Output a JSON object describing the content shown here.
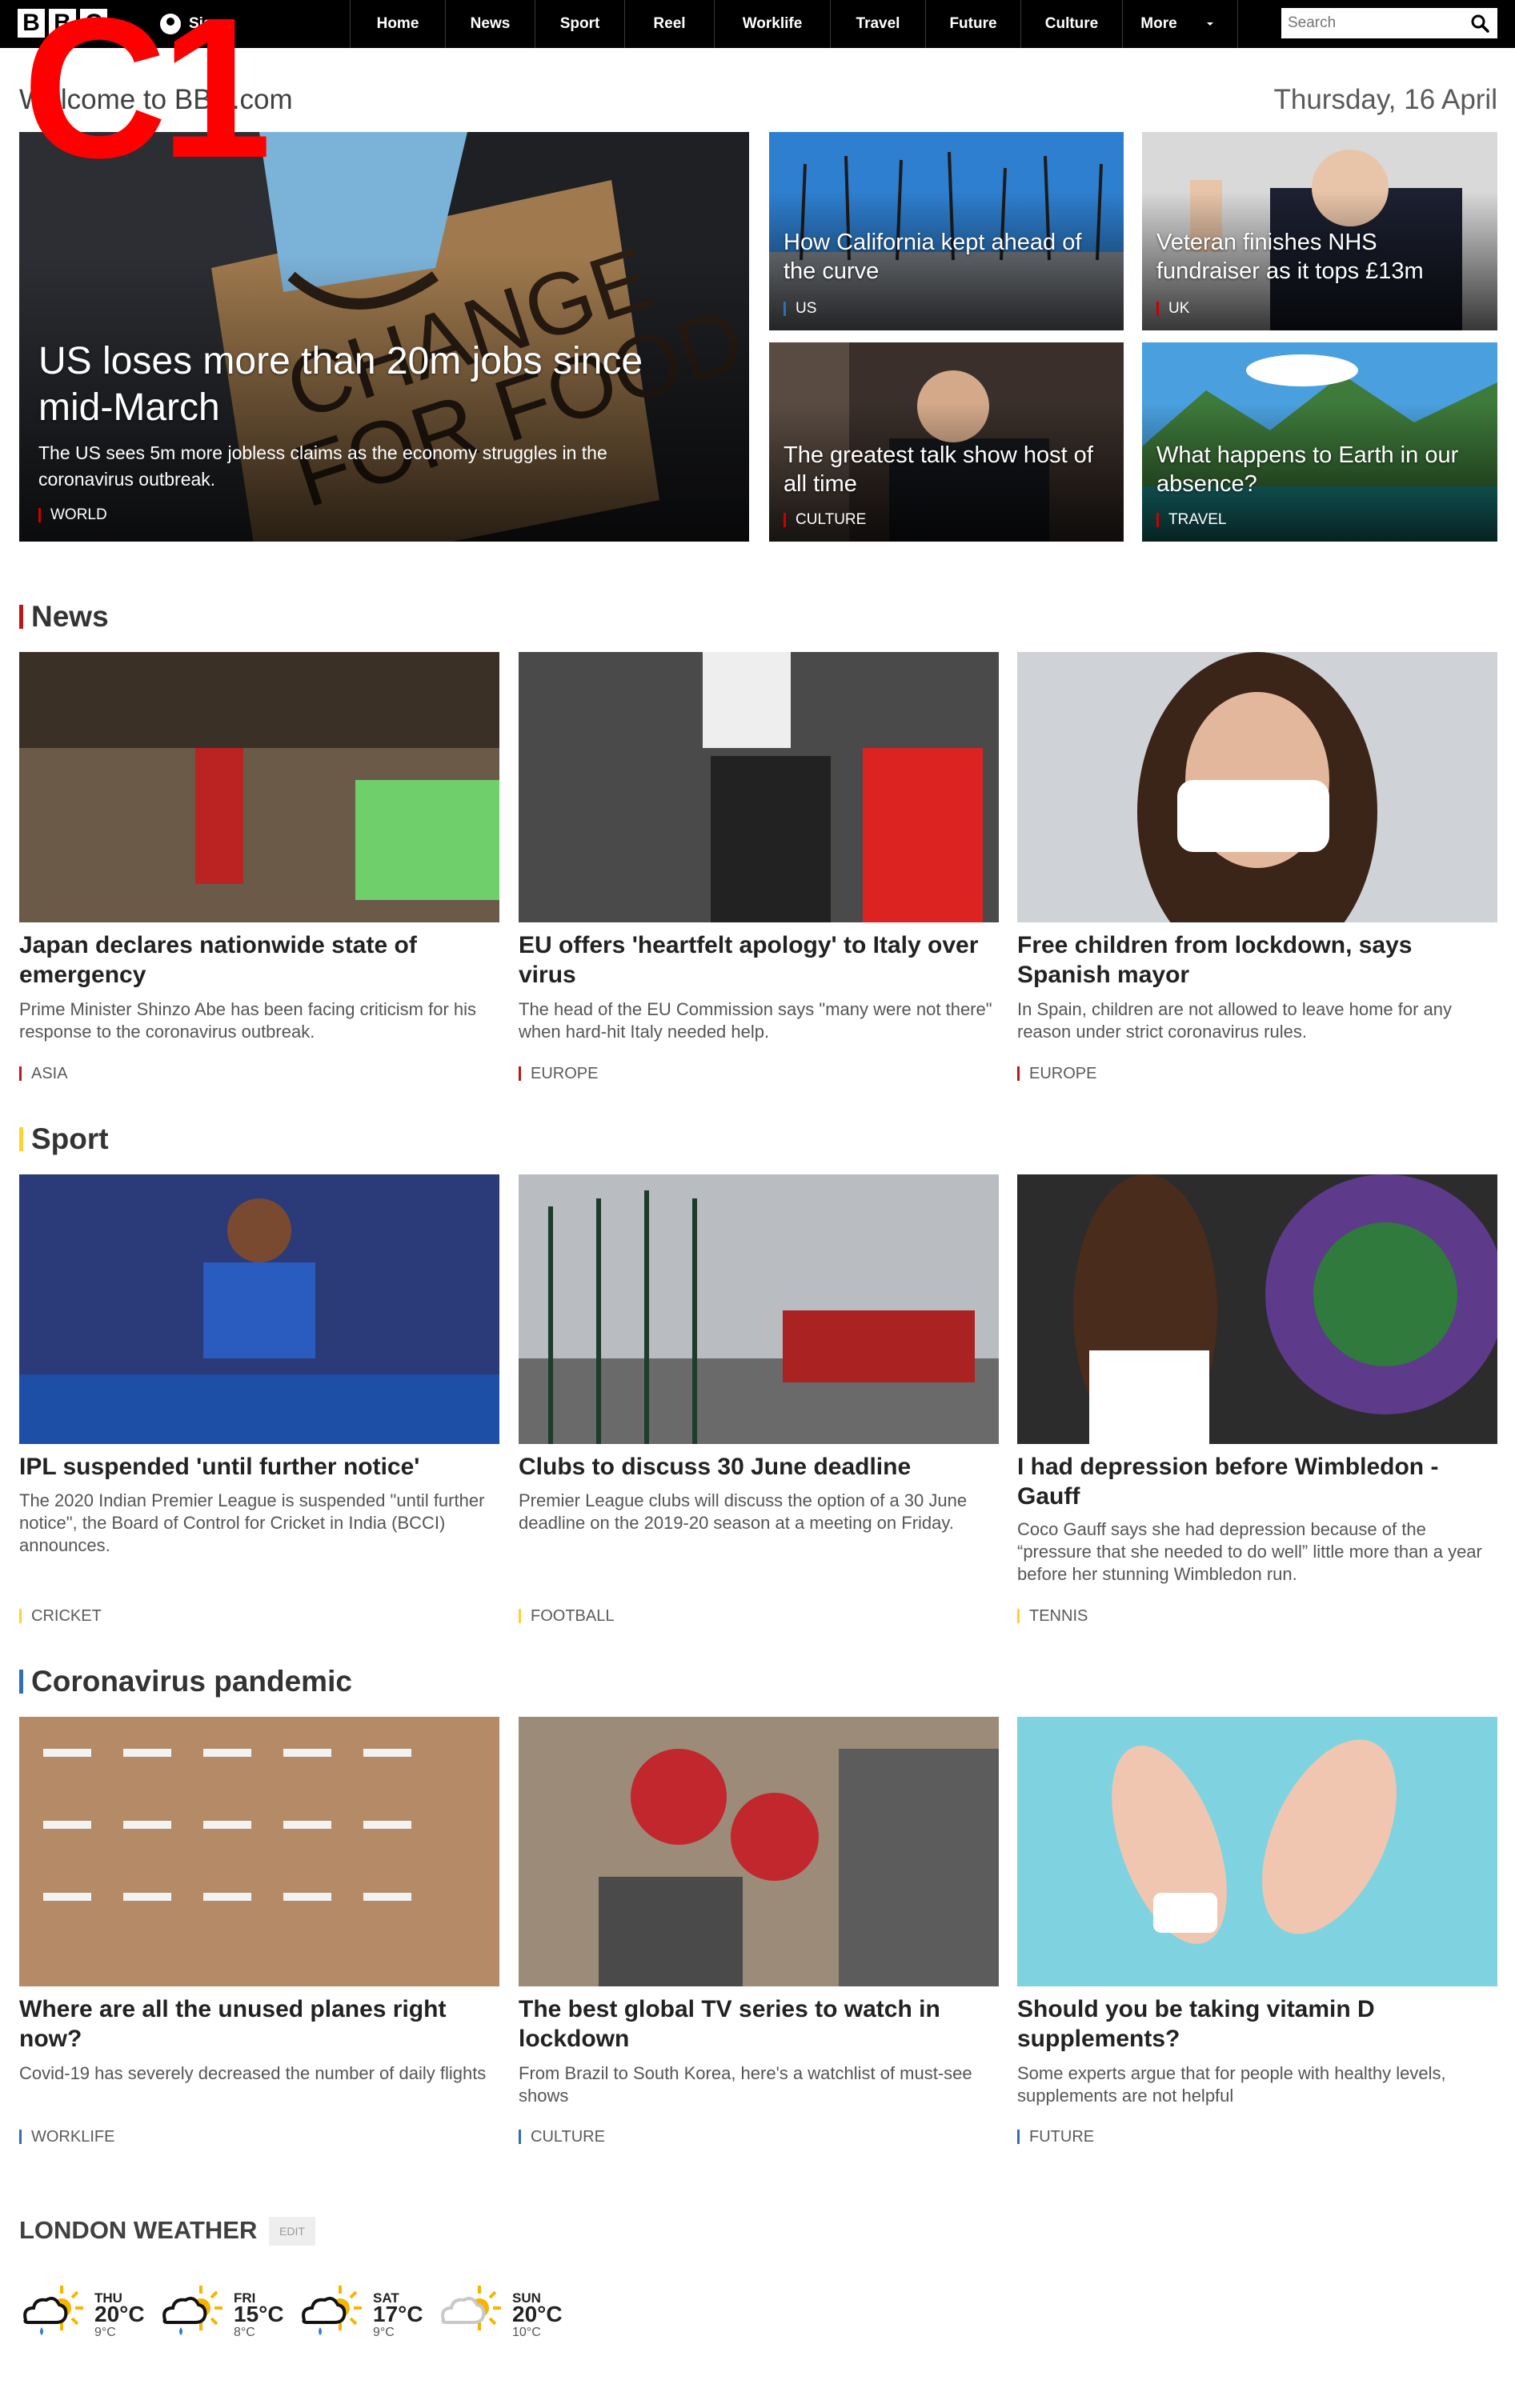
{
  "header": {
    "logo": [
      "B",
      "B",
      "C"
    ],
    "signin_label": "Sign",
    "nav": [
      "Home",
      "News",
      "Sport",
      "Reel",
      "Worklife",
      "Travel",
      "Future",
      "Culture",
      "More"
    ],
    "search_placeholder": "Search"
  },
  "overlay_label": "C1",
  "welcome": "Welcome to BBC.com",
  "date": "Thursday, 16 April",
  "hero": {
    "main": {
      "title": "US loses more than 20m jobs since mid-March",
      "summary": "The US sees 5m more jobless claims as the economy struggles in the coronavirus outbreak.",
      "category": "WORLD"
    },
    "tiles": [
      {
        "title": "How California kept ahead of the curve",
        "category": "US"
      },
      {
        "title": "Veteran finishes NHS fundraiser as it tops £13m",
        "category": "UK"
      },
      {
        "title": "The greatest talk show host of all time",
        "category": "CULTURE"
      },
      {
        "title": "What happens to Earth in our absence?",
        "category": "TRAVEL"
      }
    ]
  },
  "sections": [
    {
      "heading": "News",
      "accent": "#bb1919",
      "stories": [
        {
          "title": "Japan declares nationwide state of emergency",
          "summary": "Prime Minister Shinzo Abe has been facing criticism for his response to the coronavirus outbreak.",
          "tag": "ASIA"
        },
        {
          "title": "EU offers 'heartfelt apology' to Italy over virus",
          "summary": "The head of the EU Commission says \"many were not there\" when hard-hit Italy needed help.",
          "tag": "EUROPE"
        },
        {
          "title": "Free children from lockdown, says Spanish mayor",
          "summary": "In Spain, children are not allowed to leave home for any reason under strict coronavirus rules.",
          "tag": "EUROPE"
        }
      ]
    },
    {
      "heading": "Sport",
      "accent": "#ffd230",
      "stories": [
        {
          "title": "IPL suspended 'until further notice'",
          "summary": "The 2020 Indian Premier League is suspended \"until further notice\", the Board of Control for Cricket in India (BCCI) announces.",
          "tag": "CRICKET"
        },
        {
          "title": "Clubs to discuss 30 June deadline",
          "summary": "Premier League clubs will discuss the option of a 30 June deadline on the 2019-20 season at a meeting on Friday.",
          "tag": "FOOTBALL"
        },
        {
          "title": "I had depression before Wimbledon - Gauff",
          "summary": "Coco Gauff says she had depression because of the “pressure that she needed to do well” little more than a year before her stunning Wimbledon run.",
          "tag": "TENNIS"
        }
      ]
    },
    {
      "heading": "Coronavirus pandemic",
      "accent": "#2f6fb5",
      "stories": [
        {
          "title": "Where are all the unused planes right now?",
          "summary": "Covid-19 has severely decreased the number of daily flights",
          "tag": "WORKLIFE"
        },
        {
          "title": "The best global TV series to watch in lockdown",
          "summary": "From Brazil to South Korea, here's a watchlist of must-see shows",
          "tag": "CULTURE"
        },
        {
          "title": "Should you be taking vitamin D supplements?",
          "summary": "Some experts argue that for people with healthy levels, supplements are not helpful",
          "tag": "FUTURE"
        }
      ]
    }
  ],
  "weather": {
    "title": "LONDON WEATHER",
    "edit_label": "EDIT",
    "days": [
      {
        "day": "THU",
        "high": "20°C",
        "low": "9°C",
        "icon": "sun-cloud-rain-icon"
      },
      {
        "day": "FRI",
        "high": "15°C",
        "low": "8°C",
        "icon": "sun-cloud-rain-icon"
      },
      {
        "day": "SAT",
        "high": "17°C",
        "low": "9°C",
        "icon": "sun-cloud-rain-icon"
      },
      {
        "day": "SUN",
        "high": "20°C",
        "low": "10°C",
        "icon": "sun-cloud-icon"
      }
    ]
  }
}
